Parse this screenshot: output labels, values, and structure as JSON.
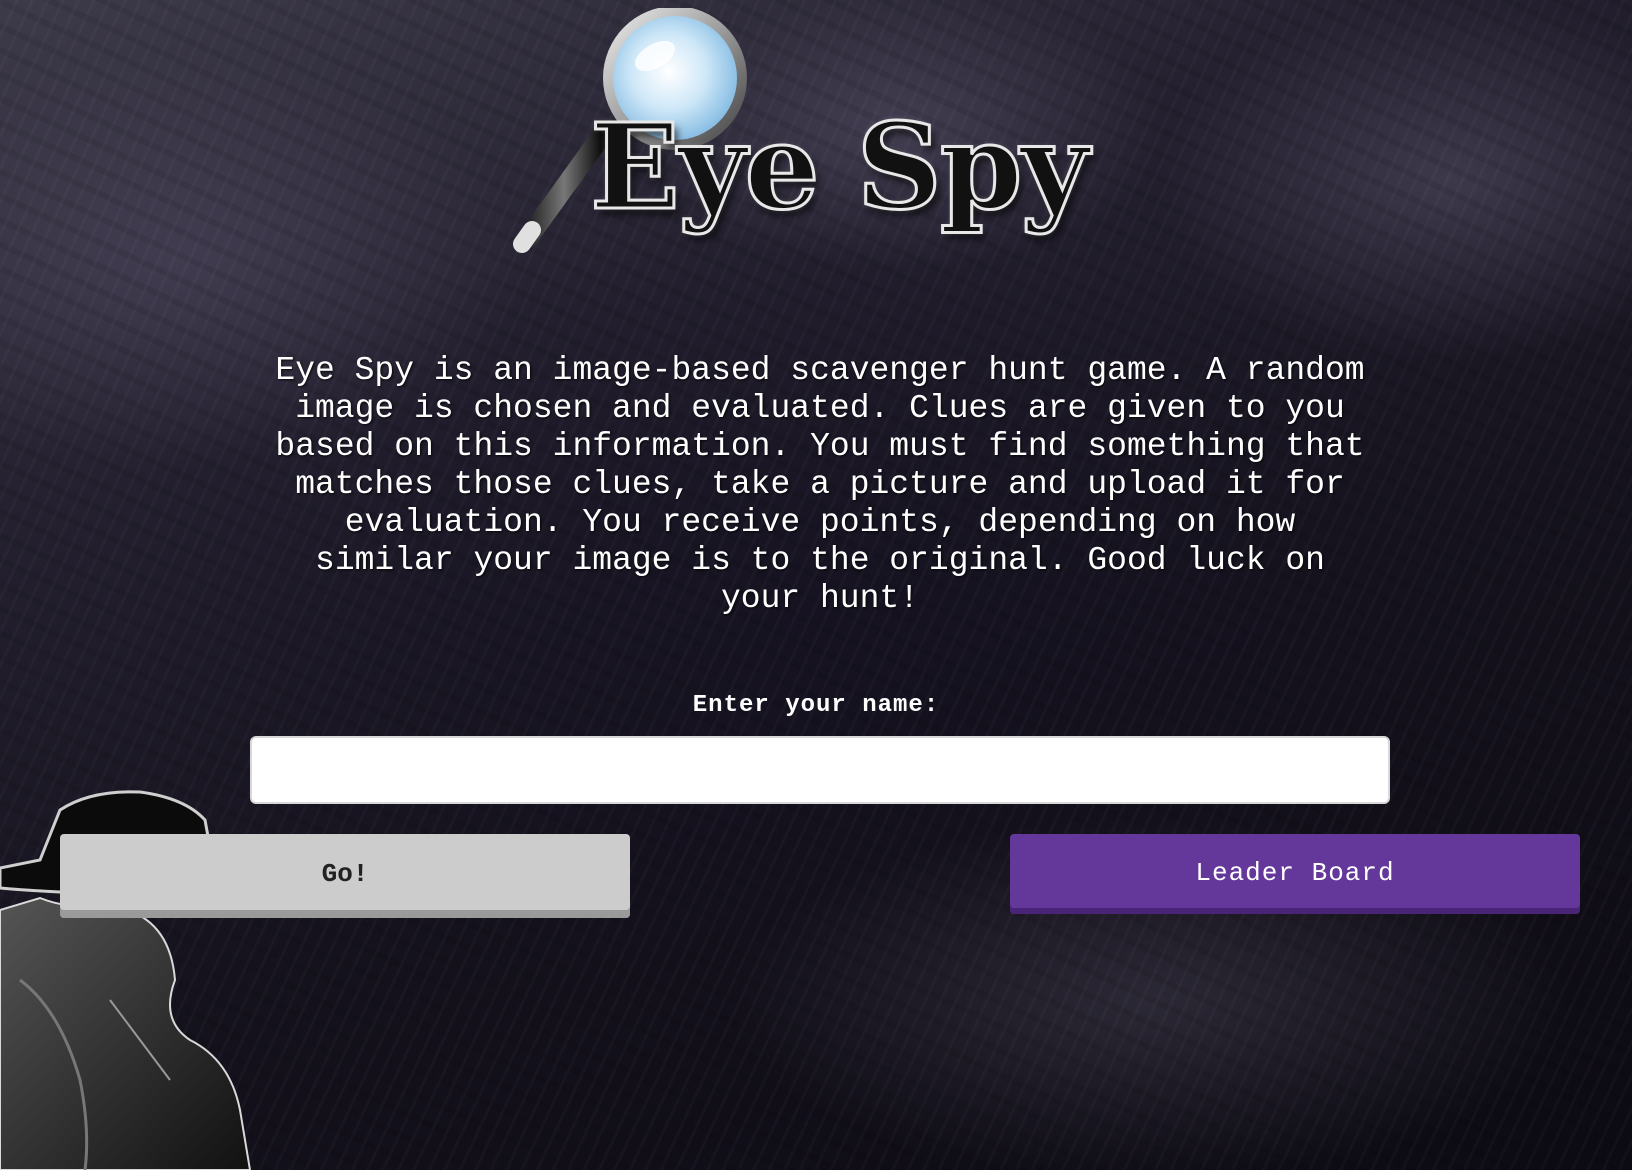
{
  "logo": {
    "title": "Eye Spy",
    "icon": "magnifying-glass-icon"
  },
  "description": "Eye Spy is an image-based scavenger hunt game. A random image is chosen and evaluated. Clues are given to you based on this information. You must find something that matches those clues, take a picture and upload it for evaluation. You receive points, depending on how similar your image is to the original. Good luck on your hunt!",
  "form": {
    "name_label": "Enter your name:",
    "name_value": "",
    "name_placeholder": ""
  },
  "buttons": {
    "go_label": "Go!",
    "leaderboard_label": "Leader Board"
  },
  "colors": {
    "leaderboard_button": "#64379a",
    "go_button": "#cccccc",
    "background": "#1a1724"
  }
}
